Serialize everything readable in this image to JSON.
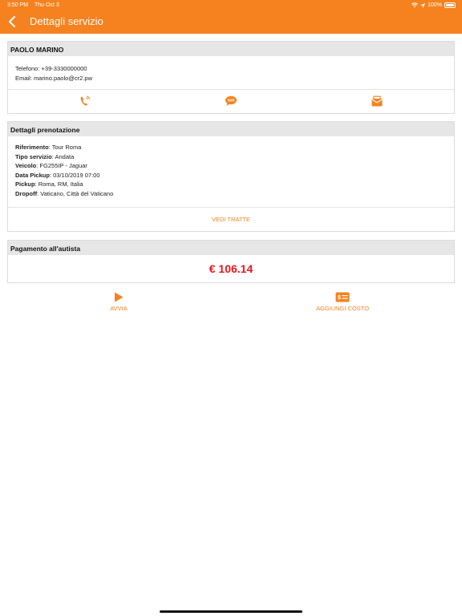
{
  "status_bar": {
    "time": "3:50 PM",
    "date": "Thu Oct 3",
    "battery": "100%"
  },
  "header": {
    "title": "Dettagli servizio"
  },
  "contact": {
    "name": "PAOLO MARINO",
    "phone_label": "Telefono:",
    "phone": "+39-3330000000",
    "email_label": "Email:",
    "email": "marino.paolo@cr2.pw",
    "actions": [
      "phone-icon",
      "sms-icon",
      "email-icon"
    ]
  },
  "booking": {
    "title": "Dettagli prenotazione",
    "rows": [
      {
        "label": "Riferimento",
        "value": ": Tour Roma"
      },
      {
        "label": "Tipo servizio",
        "value": ": Andata"
      },
      {
        "label": "Veicolo",
        "value": ": FG255IP - Jaguar"
      },
      {
        "label": "Data Pickup",
        "value": ": 03/10/2019 07:00"
      },
      {
        "label": "Pickup",
        "value": ": Roma, RM, Italia"
      },
      {
        "label": "Dropoff",
        "value": ": Vaticano, Città del Vaticano"
      }
    ],
    "link": "VEDI TRATTE"
  },
  "payment": {
    "title": "Pagamento all'autista",
    "amount": "€ 106.14"
  },
  "buttons": {
    "start": "AVVIA",
    "add_cost": "AGGIUNGI COSTO"
  },
  "colors": {
    "accent": "#f5821f",
    "amount": "#e8161b",
    "card_header": "#e6e6e6"
  }
}
